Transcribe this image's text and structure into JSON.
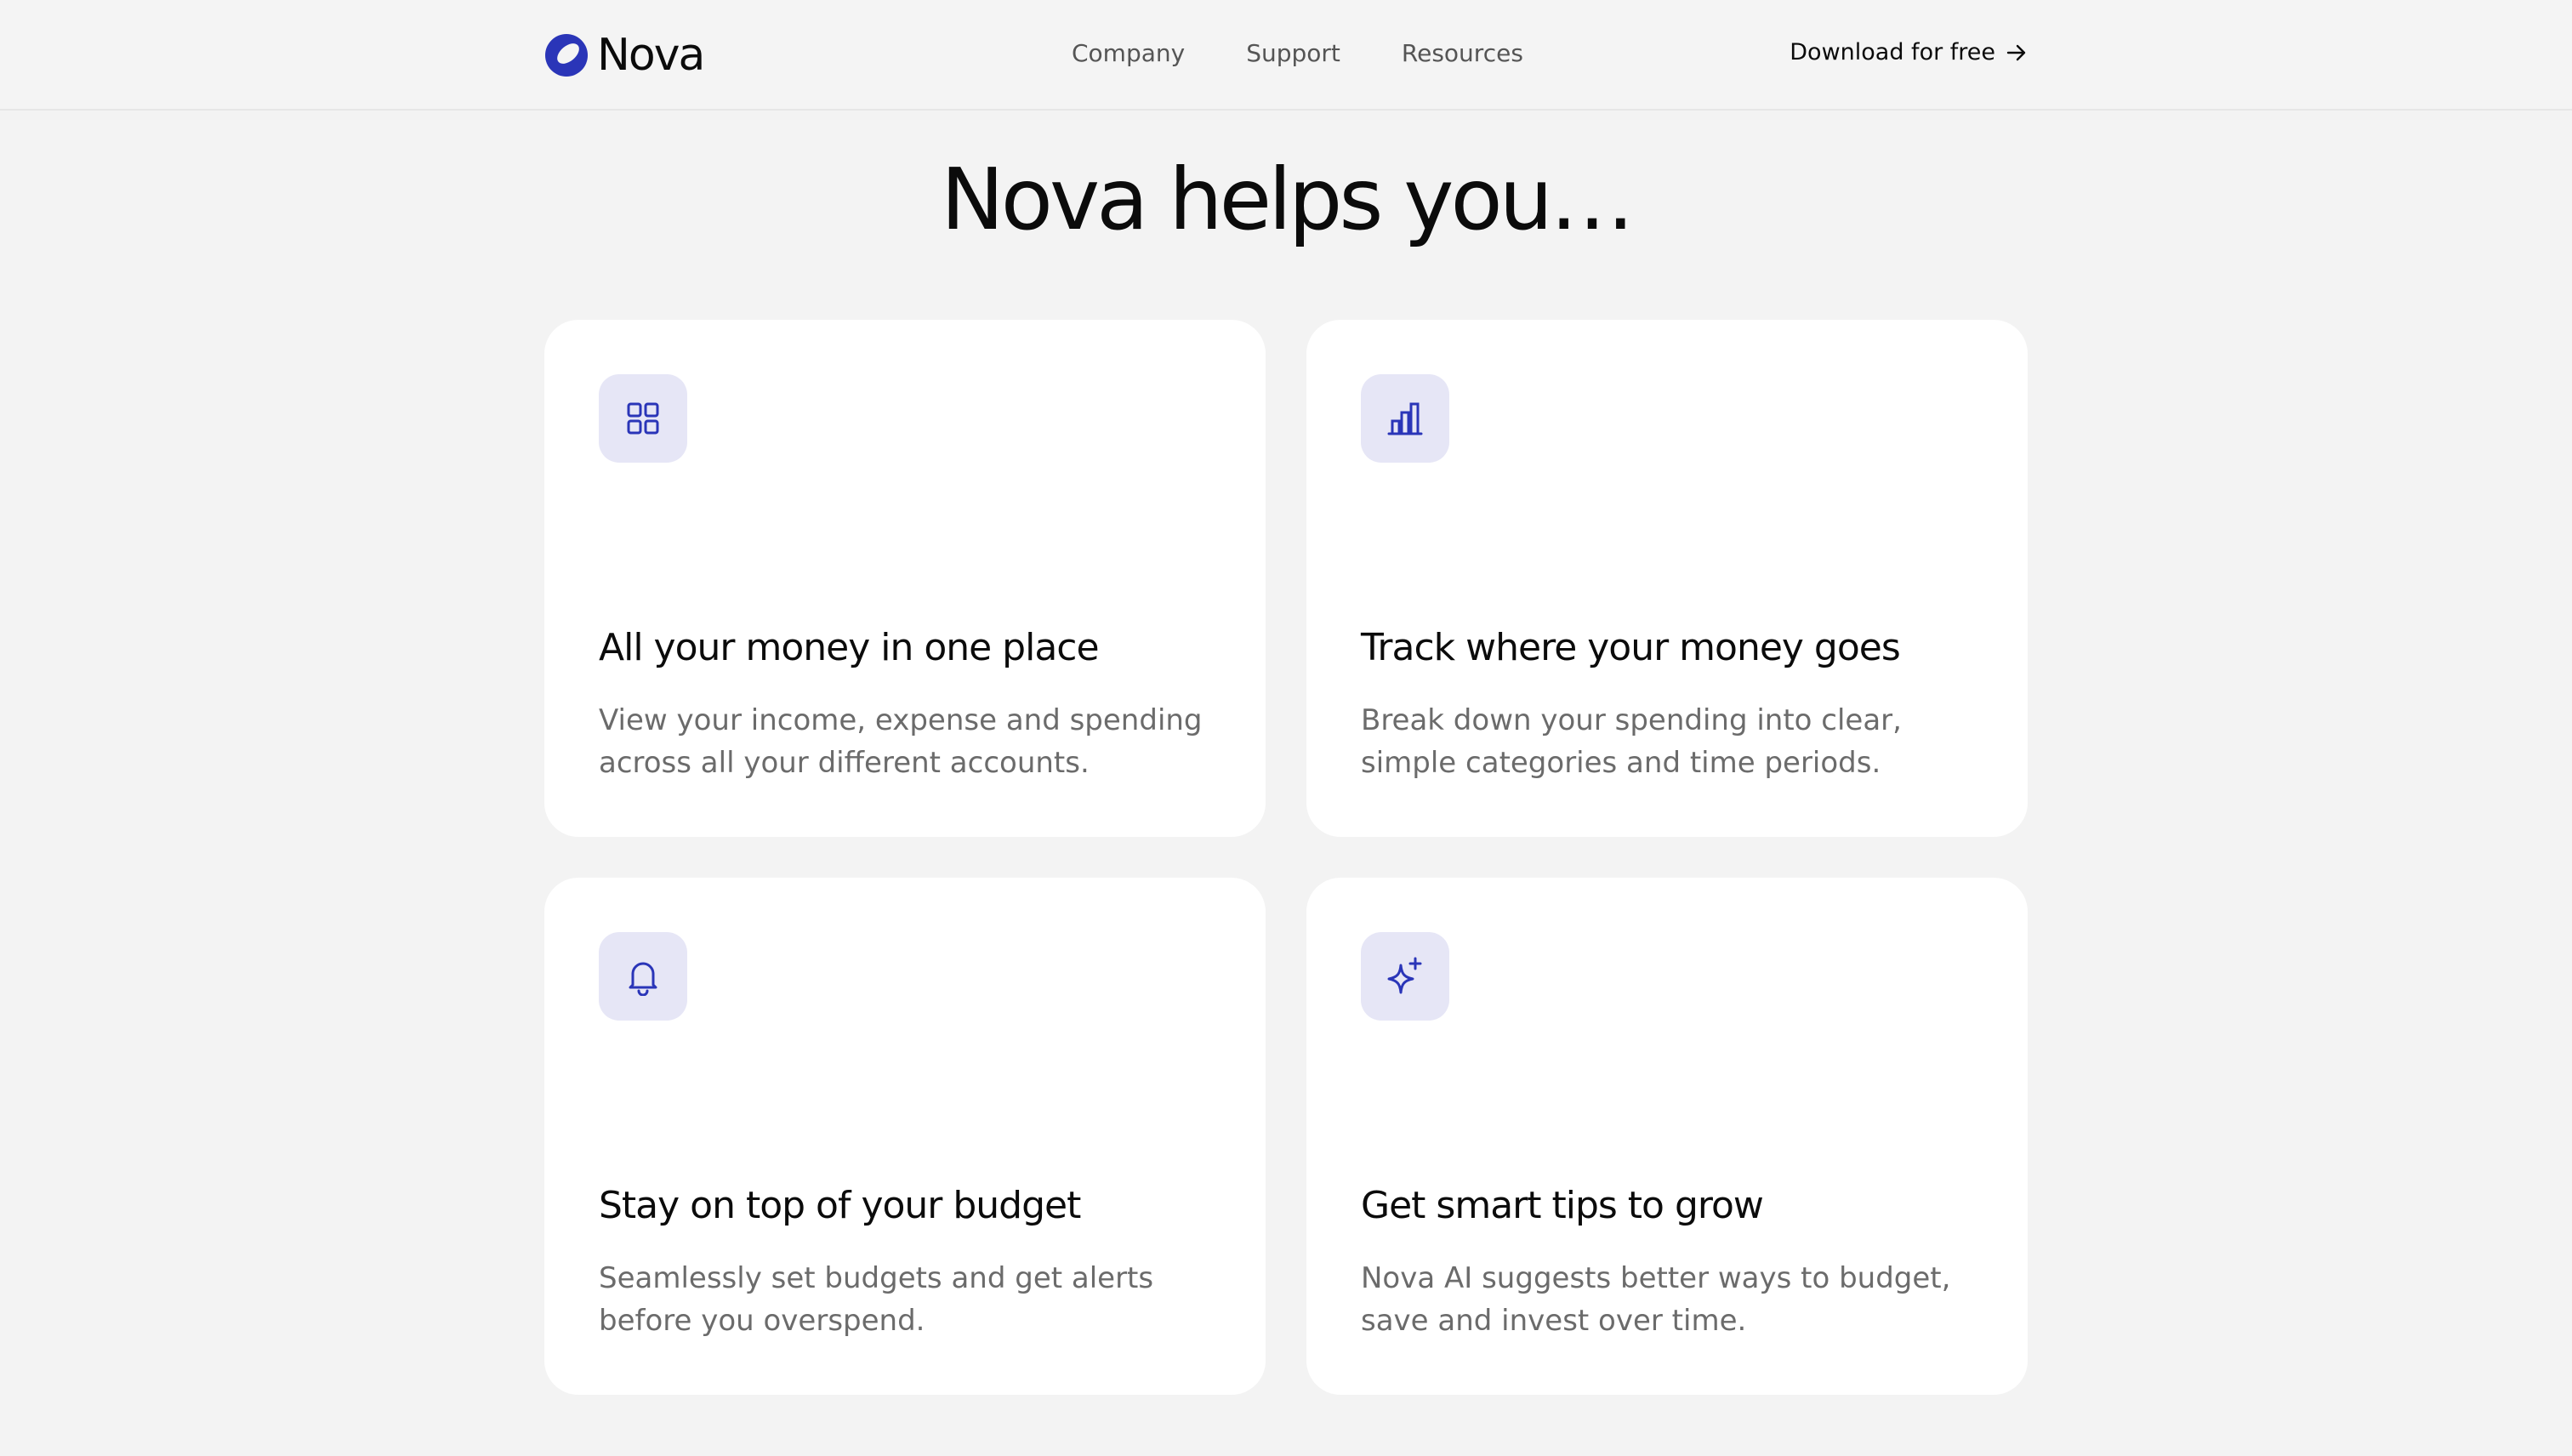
{
  "brand": {
    "name": "Nova",
    "accent": "#2a35b8",
    "icon_bg": "#e6e6f6"
  },
  "nav": {
    "links": [
      "Company",
      "Support",
      "Resources"
    ],
    "cta_label": "Download for free",
    "cta_icon": "arrow-right-icon"
  },
  "hero": {
    "headline": "Nova helps you…"
  },
  "features": [
    {
      "icon": "grid-icon",
      "title": "All your money in one place",
      "description": "View your income, expense and spending across all your different accounts."
    },
    {
      "icon": "bar-chart-icon",
      "title": "Track where your money goes",
      "description": "Break down your spending into clear, simple categories and time periods."
    },
    {
      "icon": "bell-icon",
      "title": "Stay on top of your budget",
      "description": "Seamlessly set budgets and get alerts before you overspend."
    },
    {
      "icon": "sparkles-icon",
      "title": "Get smart tips to grow",
      "description": "Nova AI suggests better ways to budget, save and invest over time."
    }
  ]
}
